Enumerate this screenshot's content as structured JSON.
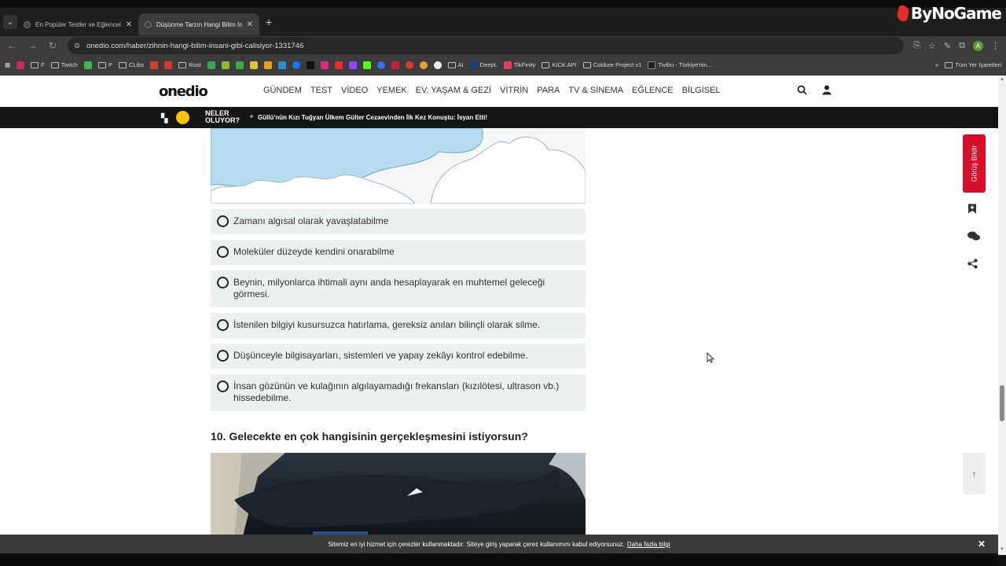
{
  "watermark": {
    "text": "ByNoGame"
  },
  "browser": {
    "tabs": [
      {
        "label": "En Popüler Testler ve Eğlenceli İçerikler",
        "active": false,
        "close": "✕"
      },
      {
        "label": "Düşünme Tarzın Hangi Bilim İnsanı",
        "active": true,
        "close": "✕"
      }
    ],
    "new_tab": "+",
    "url": "onedio.com/haber/zihnin-hangi-bilim-insani-gibi-calisiyor-1331746",
    "profile_initial": "A",
    "bookmarks": [
      {
        "label": "F",
        "type": "folder"
      },
      {
        "label": "Twitch",
        "type": "folder"
      },
      {
        "label": "P",
        "type": "folder"
      },
      {
        "label": "CLibs",
        "type": "folder"
      },
      {
        "label": "Rust",
        "type": "folder"
      },
      {
        "label": "AI",
        "type": "folder"
      },
      {
        "label": "DeepL",
        "type": "link"
      },
      {
        "label": "TikFinity",
        "type": "link"
      },
      {
        "label": "KICK API",
        "type": "folder"
      },
      {
        "label": "Coldure Project v1",
        "type": "folder"
      },
      {
        "label": "Tivibu - Türkiye'nin...",
        "type": "link"
      }
    ],
    "all_bookmarks": "Tüm Yer İşaretleri"
  },
  "site": {
    "logo": "onedio",
    "nav": [
      "GÜNDEM",
      "TEST",
      "VİDEO",
      "YEMEK",
      "EV, YAŞAM & GEZİ",
      "VİTRİN",
      "PARA",
      "TV & SİNEMA",
      "EĞLENCE",
      "BİLGİSEL"
    ],
    "ticker": {
      "label_line1": "NELER",
      "label_line2": "OLUYOR?",
      "headline": "Güllü'nün Kızı Tuğyan Ülkem Gülter Cezaevinden İlk Kez Konuştu: İsyan Etti!"
    }
  },
  "quiz": {
    "options": [
      "Zamanı algısal olarak yavaşlatabilme",
      "Moleküler düzeyde kendini onarabilme",
      "Beynin, milyonlarca ihtimali aynı anda hesaplayarak en muhtemel geleceği görmesi.",
      "İstenilen bilgiyi kusursuzca hatırlama, gereksiz anıları bilinçli olarak silme.",
      "Düşünceyle bilgisayarları, sistemleri ve yapay zekâyı kontrol edebilme.",
      "İnsan gözünün ve kulağının algılayamadığı frekansları (kızılötesi, ultrason vb.) hissedebilme."
    ],
    "next_question": "10. Gelecekte en çok hangisinin gerçekleşmesini istiyorsun?"
  },
  "sidebar": {
    "feedback": "Görüş Bildir"
  },
  "cookie": {
    "text": "Sitemiz en iyi hizmet için çerezler kullanmaktadır. Siteye giriş yaparak çerez kullanımını kabul ediyorsunuz.",
    "link": "Daha fazla bilgi",
    "close": "✕"
  },
  "colors": {
    "accent_red": "#d90f2a",
    "option_bg": "#eaf1ee",
    "ticker_bg": "#141414"
  }
}
